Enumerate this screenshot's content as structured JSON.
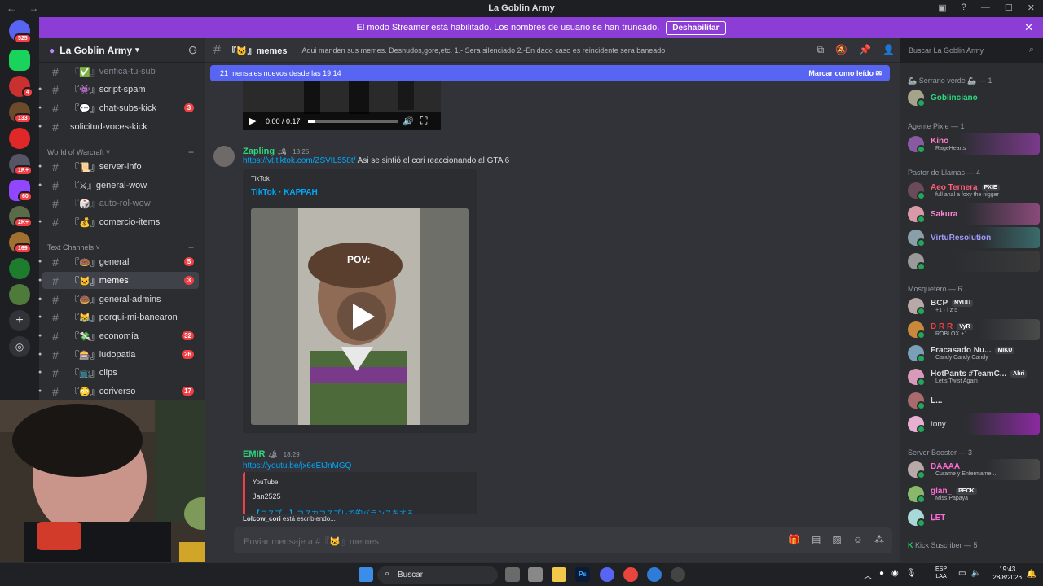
{
  "window": {
    "title": "La Goblin Army",
    "nav": "← →"
  },
  "banner": {
    "text": "El modo Streamer está habilitado. Los nombres de usuario se han truncado.",
    "button": "Deshabilitar"
  },
  "rail": {
    "badges": [
      "525",
      "4",
      "133",
      "1K+",
      "60",
      "2K+",
      "169"
    ]
  },
  "server": {
    "name": "La Goblin Army"
  },
  "channels": {
    "top": [
      {
        "label": "verifica-tu-sub",
        "muted": true
      },
      {
        "label": "script-spam"
      },
      {
        "label": "chat-subs-kick",
        "count": "3"
      },
      {
        "label": "solicitud-voces-kick"
      }
    ],
    "category_wow": "World of Warcraft",
    "wow": [
      {
        "label": "server-info"
      },
      {
        "label": "general-wow"
      },
      {
        "label": "auto-rol-wow",
        "muted": true
      },
      {
        "label": "comercio-items"
      }
    ],
    "category_text": "Text Channels",
    "text": [
      {
        "label": "general",
        "count": "5"
      },
      {
        "label": "memes",
        "count": "3"
      },
      {
        "label": "general-admins"
      },
      {
        "label": "porqui-mi-banearon"
      },
      {
        "label": "economía",
        "count": "32"
      },
      {
        "label": "ludopatia",
        "count": "26"
      },
      {
        "label": "clips"
      },
      {
        "label": "coriverso",
        "count": "17"
      }
    ]
  },
  "header": {
    "channel": "memes",
    "topic": "Aqui manden sus memes. Desnudos,gore,etc. 1.- Sera silenciado 2.-En dado caso es reincidente sera baneado",
    "search_placeholder": "Buscar La Goblin Army"
  },
  "newbar": {
    "text": "21 mensajes nuevos desde las 19:14",
    "mark": "Marcar como leído"
  },
  "video1": {
    "time": "0:00 / 0:17"
  },
  "messages": [
    {
      "user": "Zapling",
      "time": "18:25",
      "link": "https://vt.tiktok.com/ZSVtL558t/",
      "text": "Asi se sintió el cori reaccionando al GTA 6",
      "embed_provider": "TikTok",
      "embed_title": "TikTok · KAPPAH",
      "overlay": "POV:"
    },
    {
      "user": "EMIR",
      "time": "18:29",
      "link": "https://youtu.be/jx6eEtJnMGQ",
      "embed_provider": "YouTube",
      "embed_title": "Jan2525",
      "embed_sub": "【コスプレ】コスカコスプレで的バランスをする"
    }
  ],
  "typing": {
    "user": "Lolcow_cori",
    "text": "está escribiendo..."
  },
  "composer": {
    "placeholder": "Enviar mensaje a #『🐱』memes"
  },
  "members": {
    "roles": [
      "🦾 Serrano verde 🦾 — 1",
      "Agente Pixie — 1",
      "Pastor de Llamas — 4",
      "Mosquetero — 6",
      "Server Booster — 3",
      "Kick Suscriber — 5"
    ],
    "list": [
      {
        "name": "Goblinciano",
        "color": "#2dd87f"
      },
      {
        "name": "Kino",
        "color": "#ff7dc4",
        "status": "RageHearts"
      },
      {
        "name": "Aeo    Ternera",
        "color": "#ff5f7a",
        "tag": "PXIE",
        "status": "full anal a foxy the nigger"
      },
      {
        "name": "Sakura",
        "color": "#ff85d8"
      },
      {
        "name": "VirtuResolution",
        "color": "#9f9bff"
      },
      {
        "name": "",
        "color": "#ffffff"
      },
      {
        "name": "BCP",
        "color": "#dbdee1",
        "tag": "NYUU",
        "status": "+1 · i z 5"
      },
      {
        "name": "D R   R",
        "color": "#f23f43",
        "tag": "VyR",
        "status": "ROBLOX +1"
      },
      {
        "name": "Fracasado Nu...",
        "color": "#dbdee1",
        "tag": "MIKU",
        "status": "Candy Candy Candy"
      },
      {
        "name": "HotPants #TeamC...",
        "color": "#dbdee1",
        "tag": "Ahri",
        "status": "Let's Twist Again"
      },
      {
        "name": "L...",
        "color": "#dbdee1"
      },
      {
        "name": "tony",
        "color": "#dbdee1"
      },
      {
        "name": "DAAAA",
        "color": "#ff6bd6",
        "status": "Curame y Enfermame..."
      },
      {
        "name": "glan_",
        "color": "#ff6bd6",
        "tag": "PECK",
        "status": "Miss Papaya"
      },
      {
        "name": "ᒪET",
        "color": "#ff6bd6"
      }
    ]
  },
  "taskbar": {
    "search": "Buscar",
    "lang": "ESP\nLAA",
    "time": "19:43",
    "date": "28/8/2026"
  }
}
